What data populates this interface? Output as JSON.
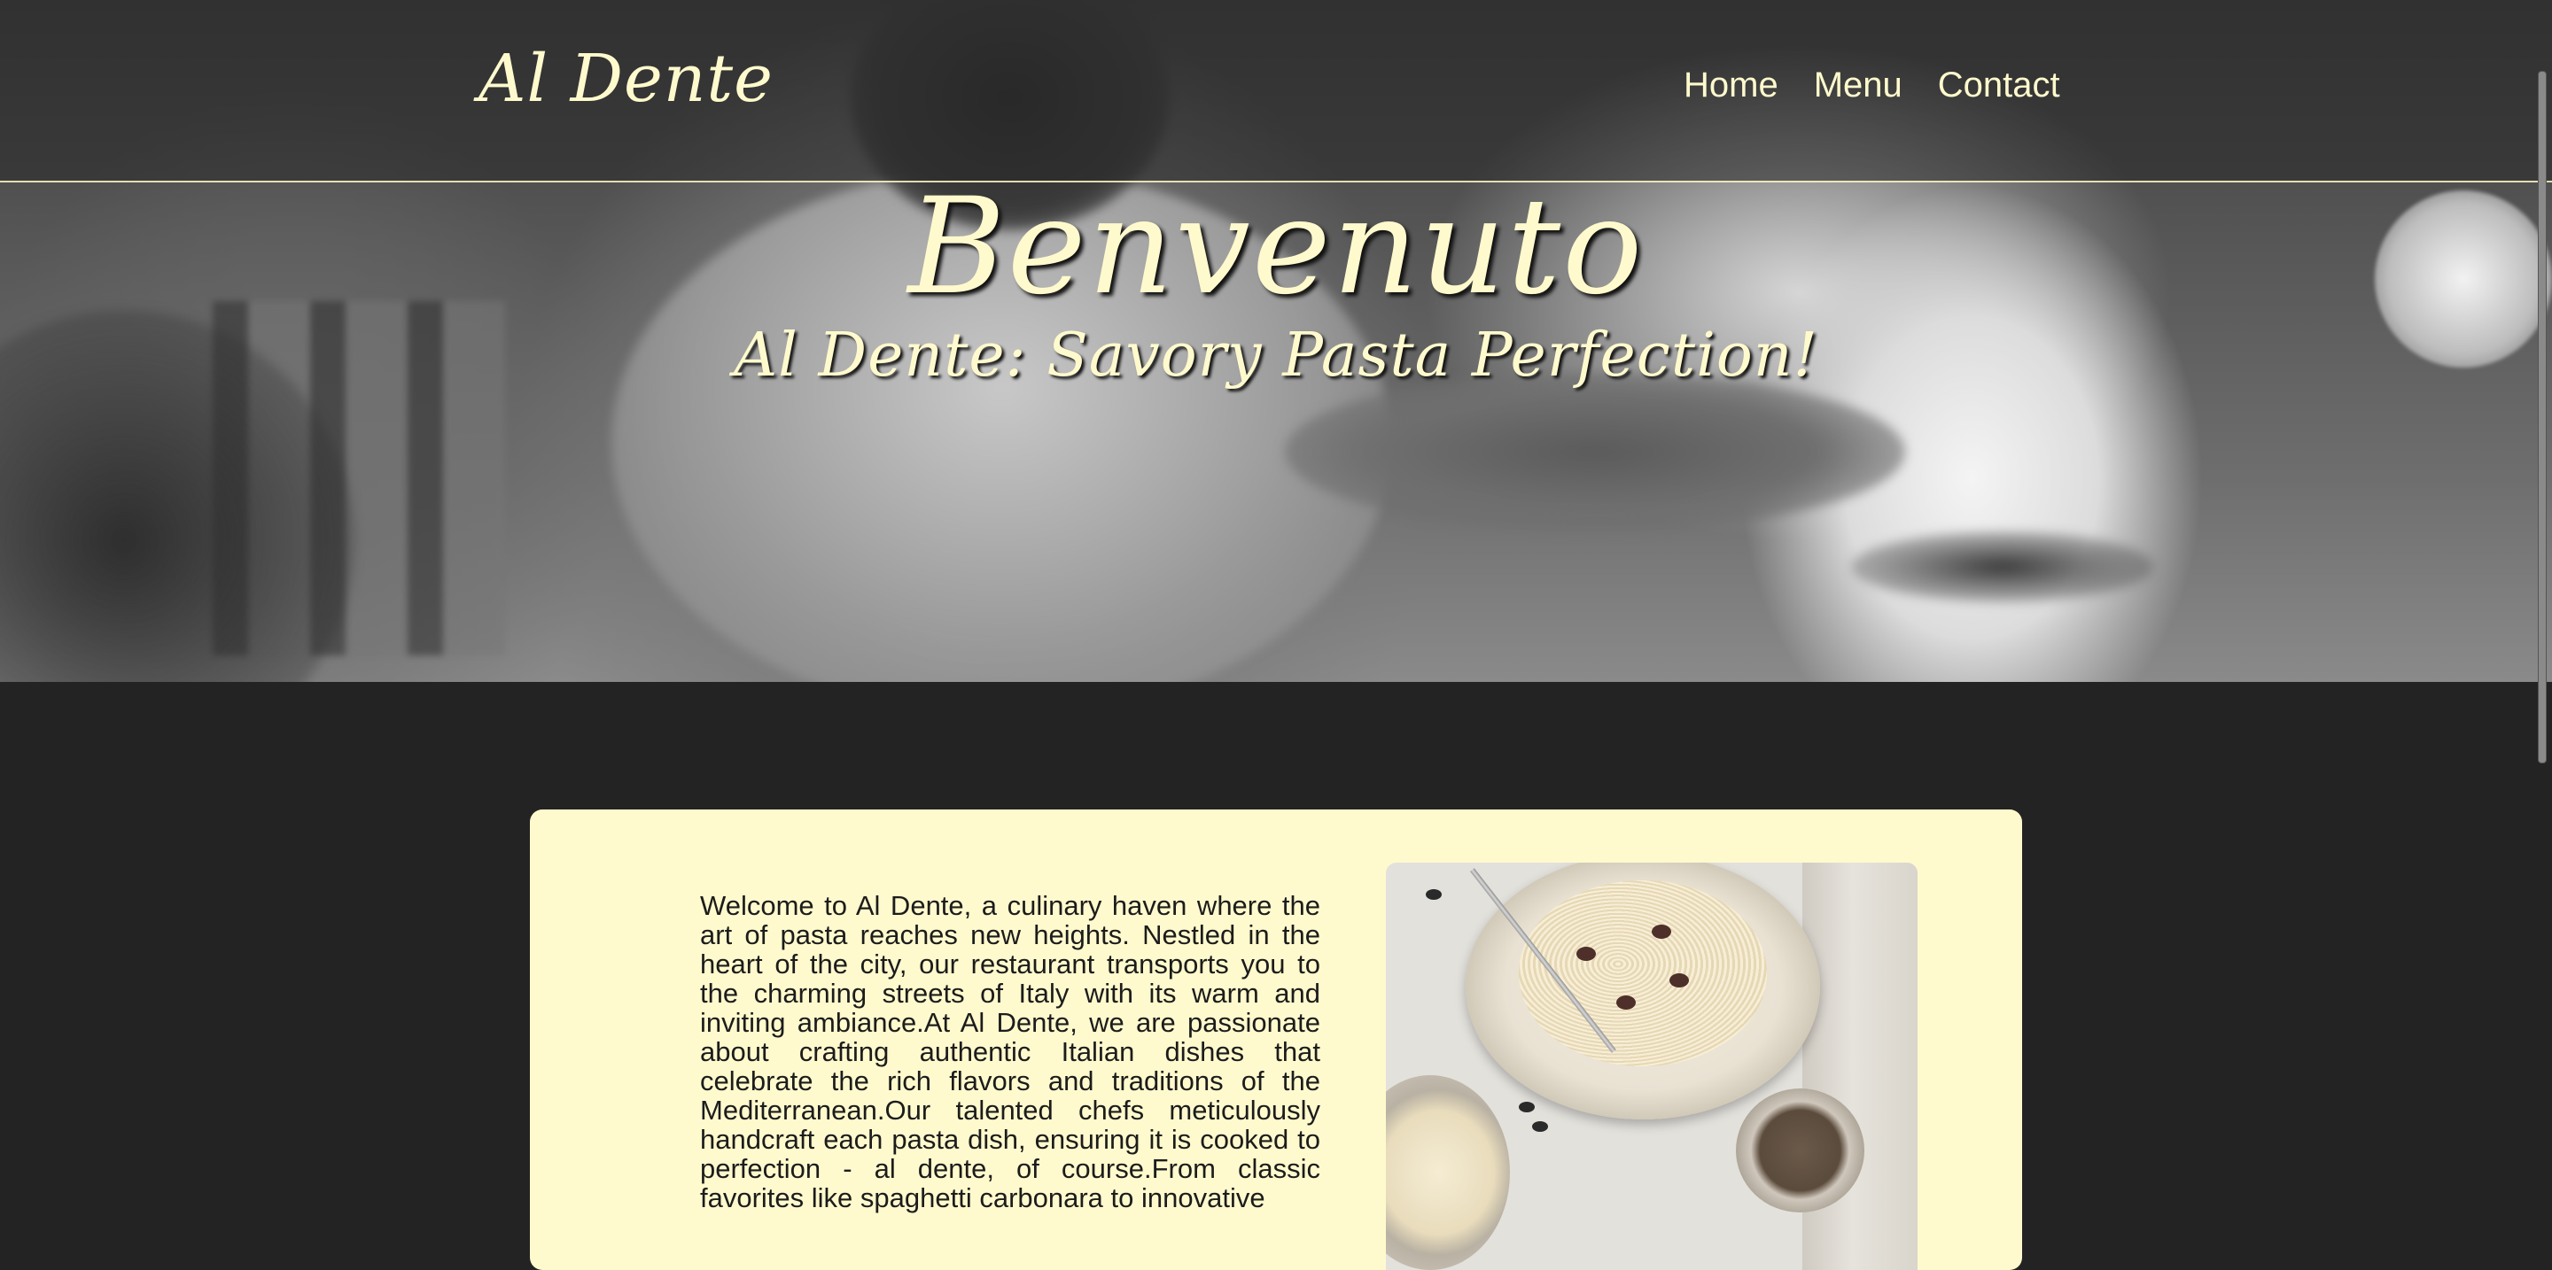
{
  "header": {
    "logo": "Al Dente",
    "nav": [
      "Home",
      "Menu",
      "Contact"
    ]
  },
  "hero": {
    "title": "Benvenuto",
    "subtitle": "Al Dente: Savory Pasta Perfection!"
  },
  "about": {
    "text": "Welcome to Al Dente, a culinary haven where the art of pasta reaches new heights. Nestled in the heart of the city, our restaurant transports you to the charming streets of Italy with its warm and inviting ambiance.At Al Dente, we are passionate about crafting authentic Italian dishes that celebrate the rich flavors and traditions of the Mediterranean.Our talented chefs meticulously handcraft each pasta dish, ensuring it is cooked to perfection - al dente, of course.From classic favorites like spaghetti carbonara to innovative"
  },
  "colors": {
    "accent": "#fffacd",
    "background": "#232323",
    "text": "#1c1c1c"
  }
}
